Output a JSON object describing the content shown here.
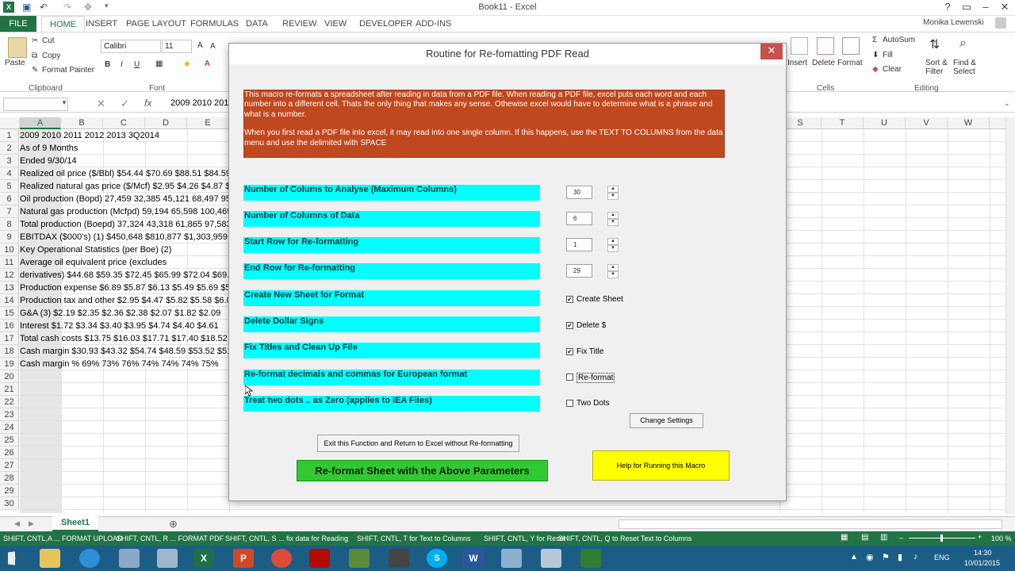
{
  "window": {
    "title": "Book11 - Excel",
    "user": "Monika Lewenski"
  },
  "ribbon_tabs": [
    "FILE",
    "HOME",
    "INSERT",
    "PAGE LAYOUT",
    "FORMULAS",
    "DATA",
    "REVIEW",
    "VIEW",
    "DEVELOPER",
    "ADD-INS"
  ],
  "ribbon": {
    "paste": "Paste",
    "cut": "Cut",
    "copy": "Copy",
    "format_painter": "Format Painter",
    "clipboard": "Clipboard",
    "font_name": "Calibri",
    "font_size": "11",
    "font_group": "Font",
    "bold": "B",
    "italic": "I",
    "underline": "U",
    "insert": "Insert",
    "delete": "Delete",
    "format": "Format",
    "cells": "Cells",
    "autosum": "AutoSum",
    "fill": "Fill",
    "clear": "Clear",
    "sort_filter": "Sort & Filter",
    "find_select": "Find & Select",
    "editing": "Editing"
  },
  "formula_bar": {
    "cell_ref": "",
    "fx": "fx",
    "content": "2009 2010 201"
  },
  "columns": [
    "A",
    "B",
    "C",
    "D",
    "E",
    "S",
    "T",
    "U",
    "V",
    "W"
  ],
  "rows": [
    {
      "n": "1",
      "text": "2009 2010 2011 2012 2013 3Q2014"
    },
    {
      "n": "2",
      "text": "As of 9 Months"
    },
    {
      "n": "3",
      "text": "Ended 9/30/14"
    },
    {
      "n": "4",
      "text": "Realized oil price ($/Bbl) $54.44 $70.69 $88.51 $84.59"
    },
    {
      "n": "5",
      "text": "Realized natural gas price ($/Mcf) $2.95 $4.26 $4.87 $"
    },
    {
      "n": "6",
      "text": "Oil production (Bopd) 27,459 32,385 45,121 68,497 95,"
    },
    {
      "n": "7",
      "text": "Natural gas production (Mcfpd) 59,194 65,598 100,469"
    },
    {
      "n": "8",
      "text": "Total production (Boepd) 37,324 43,318 61,865 97,583"
    },
    {
      "n": "9",
      "text": "EBITDAX ($000's) (1) $450,648 $810,877 $1,303,959 $1"
    },
    {
      "n": "10",
      "text": "Key Operational Statistics (per Boe) (2)"
    },
    {
      "n": "11",
      "text": "Average oil equivalent price (excludes"
    },
    {
      "n": "12",
      "text": "derivatives) $44.68 $59.35 $72.45 $65.99 $72.04 $69.0"
    },
    {
      "n": "13",
      "text": "Production expense $6.89 $5.87 $6.13 $5.49 $5.69 $5."
    },
    {
      "n": "14",
      "text": "Production tax and other $2.95 $4.47 $5.82 $5.58 $6.0"
    },
    {
      "n": "15",
      "text": "G&A (3) $2.19 $2.35 $2.36 $2.38 $2.07 $1.82 $2.09"
    },
    {
      "n": "16",
      "text": "Interest $1.72 $3.34 $3.40 $3.95 $4.74 $4.40 $4.61"
    },
    {
      "n": "17",
      "text": "Total cash costs $13.75 $16.03 $17.71 $17.40 $18.52 $"
    },
    {
      "n": "18",
      "text": "Cash margin $30.93 $43.32 $54.74 $48.59 $53.52 $51."
    },
    {
      "n": "19",
      "text": "Cash margin % 69% 73% 76% 74% 74% 74% 75%"
    },
    {
      "n": "20",
      "text": ""
    },
    {
      "n": "21",
      "text": ""
    },
    {
      "n": "22",
      "text": ""
    },
    {
      "n": "23",
      "text": ""
    },
    {
      "n": "24",
      "text": ""
    },
    {
      "n": "25",
      "text": ""
    },
    {
      "n": "26",
      "text": ""
    },
    {
      "n": "27",
      "text": ""
    },
    {
      "n": "28",
      "text": ""
    },
    {
      "n": "29",
      "text": ""
    },
    {
      "n": "30",
      "text": ""
    }
  ],
  "sheet_tab": "Sheet1",
  "status_items": [
    "SHIFT, CNTL,A ... FORMAT UPLOAD",
    "SHIFT, CNTL, R ... FORMAT PDF",
    "SHIFT, CNTL, S ... fix data for Reading",
    "SHIFT, CNTL, T  for Text to Columns",
    "SHIFT, CNTL, Y  for Reset",
    "SHIFT, CNTL, Q to Reset Text to Columns"
  ],
  "zoom": "100 %",
  "clock": {
    "time": "14:30",
    "date": "10/01/2015"
  },
  "lang": "ENG",
  "dialog": {
    "title": "Routine for Re-fomatting PDF Read",
    "close": "✕",
    "info_p1": "This macro re-formats a spreadsheet after reading in data from a PDF file.  When reading a PDF file, excel puts each word and each number into a different cell.  Thats the only thing that makes any sense.  Othewise excel would have to determine what is a phrase and what is a number.",
    "info_p2": "When you first read a PDF file into excel, it may read into one single column.  If this happens, use the TEXT TO COLUMNS from the data menu and use the delimited with SPACE",
    "fields": [
      {
        "label": "Number of Colums to Analyse (Maximum Columns)",
        "value": "30"
      },
      {
        "label": " Number of Columns of Data",
        "value": "6"
      },
      {
        "label": "Start Row for Re-formatting",
        "value": "1"
      },
      {
        "label": "End Row for Re-formatting",
        "value": "29"
      }
    ],
    "options": [
      {
        "label": "Create New Sheet for Format",
        "check": "Create Sheet",
        "checked": "✔"
      },
      {
        "label": "Delete Dollar Signs",
        "check": "Delete $",
        "checked": "✔"
      },
      {
        "label": "Fix Titles and Clean Up File",
        "check": "Fix Title",
        "checked": "✔"
      },
      {
        "label": " Re-format decimals and commas for European format",
        "check": "Re-format",
        "checked": ""
      },
      {
        "label": "Treat two dots  .. as Zero (applies to IEA Files)",
        "check": "Two Dots",
        "checked": ""
      }
    ],
    "change_settings": "Change Settings",
    "exit_button": "Exit this Function and Return to Excel without Re-formatting",
    "reformat_button": "Re-format Sheet with the Above Parameters",
    "help_button": "Help for Running this Macro"
  }
}
